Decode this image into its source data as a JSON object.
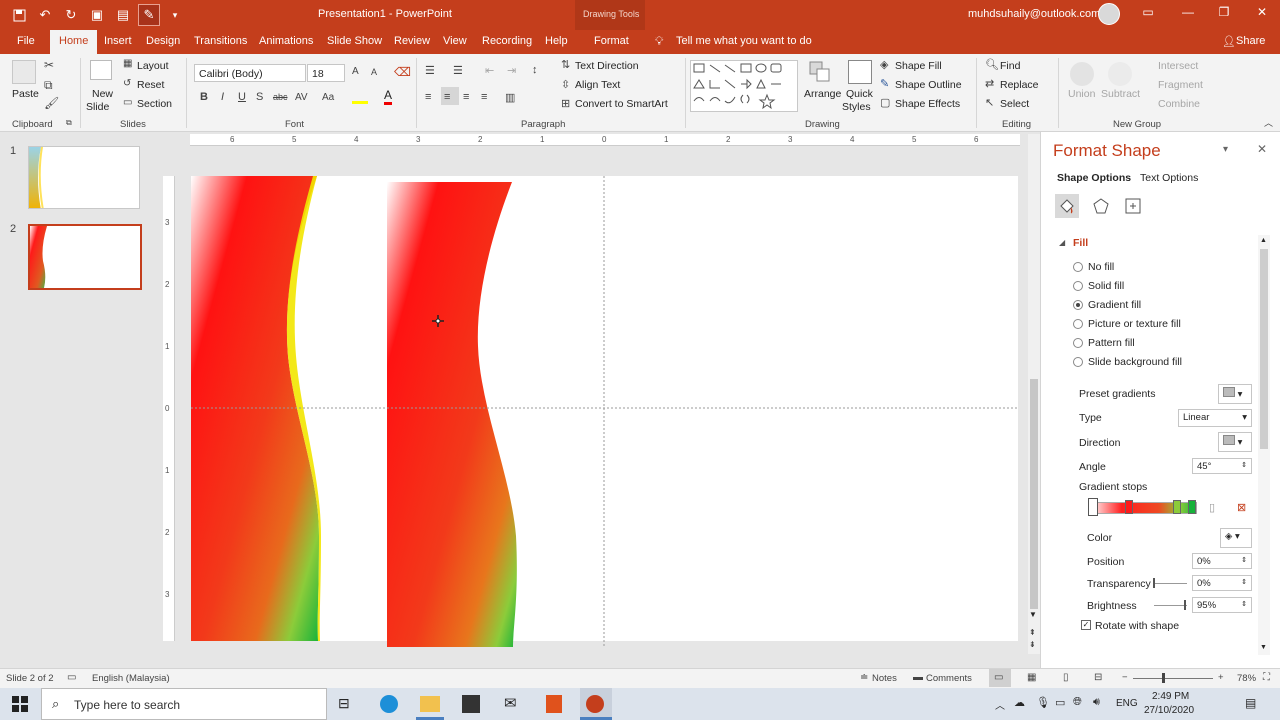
{
  "titlebar": {
    "doc_title": "Presentation1 - PowerPoint",
    "context_title": "Drawing Tools",
    "account": "muhdsuhaily@outlook.com"
  },
  "tabs": [
    "File",
    "Home",
    "Insert",
    "Design",
    "Transitions",
    "Animations",
    "Slide Show",
    "Review",
    "View",
    "Recording",
    "Help",
    "Format"
  ],
  "active_tab": "Home",
  "tell_me": "Tell me what you want to do",
  "share": "Share",
  "ribbon": {
    "clipboard": {
      "paste": "Paste",
      "label": "Clipboard"
    },
    "slides": {
      "new_slide_1": "New",
      "new_slide_2": "Slide",
      "layout": "Layout",
      "reset": "Reset",
      "section": "Section",
      "label": "Slides"
    },
    "font": {
      "name": "Calibri (Body)",
      "size": "18",
      "label": "Font"
    },
    "paragraph": {
      "text_direction": "Text Direction",
      "align_text": "Align Text",
      "convert": "Convert to SmartArt",
      "label": "Paragraph"
    },
    "drawing": {
      "arrange": "Arrange",
      "quick_1": "Quick",
      "quick_2": "Styles",
      "shape_fill": "Shape Fill",
      "shape_outline": "Shape Outline",
      "shape_effects": "Shape Effects",
      "label": "Drawing"
    },
    "editing": {
      "find": "Find",
      "replace": "Replace",
      "select": "Select",
      "label": "Editing"
    },
    "new_group": {
      "union": "Union",
      "subtract": "Subtract",
      "intersect": "Intersect",
      "fragment": "Fragment",
      "combine": "Combine",
      "label": "New Group"
    }
  },
  "thumbnails": [
    {
      "num": "1"
    },
    {
      "num": "2"
    }
  ],
  "ruler": {
    "h": [
      "6",
      "5",
      "4",
      "3",
      "2",
      "1",
      "0",
      "1",
      "2",
      "3",
      "4",
      "5",
      "6"
    ],
    "v": [
      "3",
      "2",
      "1",
      "0",
      "1",
      "2",
      "3"
    ]
  },
  "pane": {
    "title": "Format Shape",
    "tab_shape": "Shape Options",
    "tab_text": "Text Options",
    "section_fill": "Fill",
    "options": [
      "No fill",
      "Solid fill",
      "Gradient fill",
      "Picture or texture fill",
      "Pattern fill",
      "Slide background fill"
    ],
    "selected_option": "Gradient fill",
    "preset_gradients": "Preset gradients",
    "type_label": "Type",
    "type_value": "Linear",
    "direction_label": "Direction",
    "angle_label": "Angle",
    "angle_value": "45°",
    "gradient_stops": "Gradient stops",
    "color_label": "Color",
    "position_label": "Position",
    "position_value": "0%",
    "transparency_label": "Transparency",
    "transparency_value": "0%",
    "brightness_label": "Brightness",
    "brightness_value": "95%",
    "rotate_label": "Rotate with shape",
    "rotate_checked": true
  },
  "status": {
    "slide": "Slide 2 of 2",
    "language": "English (Malaysia)",
    "notes": "Notes",
    "comments": "Comments",
    "zoom": "78%"
  },
  "taskbar": {
    "search_placeholder": "Type here to search",
    "lang": "ENG",
    "time": "2:49 PM",
    "date": "27/10/2020"
  }
}
